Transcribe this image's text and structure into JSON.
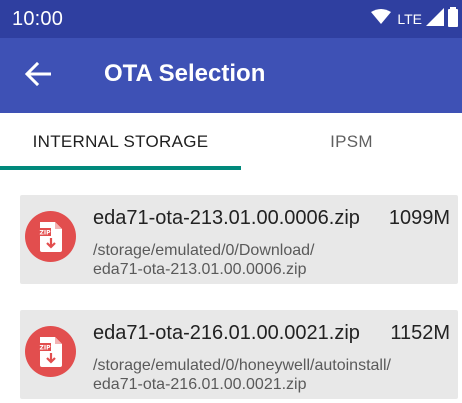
{
  "status_bar": {
    "time": "10:00",
    "network": "LTE",
    "icons": [
      "wifi-icon",
      "signal-icon",
      "battery-icon"
    ]
  },
  "app_bar": {
    "title": "OTA Selection",
    "back_icon": "arrow-back-icon",
    "color": "#3e51b5"
  },
  "tabs": [
    {
      "label": "INTERNAL STORAGE",
      "selected": true
    },
    {
      "label": "IPSM",
      "selected": false
    }
  ],
  "accent_color": "#00897b",
  "files": [
    {
      "name": "eda71-ota-213.01.00.0006.zip",
      "size": "1099M",
      "path_line1": "/storage/emulated/0/Download/",
      "path_line2": "eda71-ota-213.01.00.0006.zip",
      "icon": "zip-file-icon"
    },
    {
      "name": "eda71-ota-216.01.00.0021.zip",
      "size": "1152M",
      "path_line1": "/storage/emulated/0/honeywell/autoinstall/",
      "path_line2": "eda71-ota-216.01.00.0021.zip",
      "icon": "zip-file-icon"
    }
  ],
  "zip_icon_label": "ZIP"
}
